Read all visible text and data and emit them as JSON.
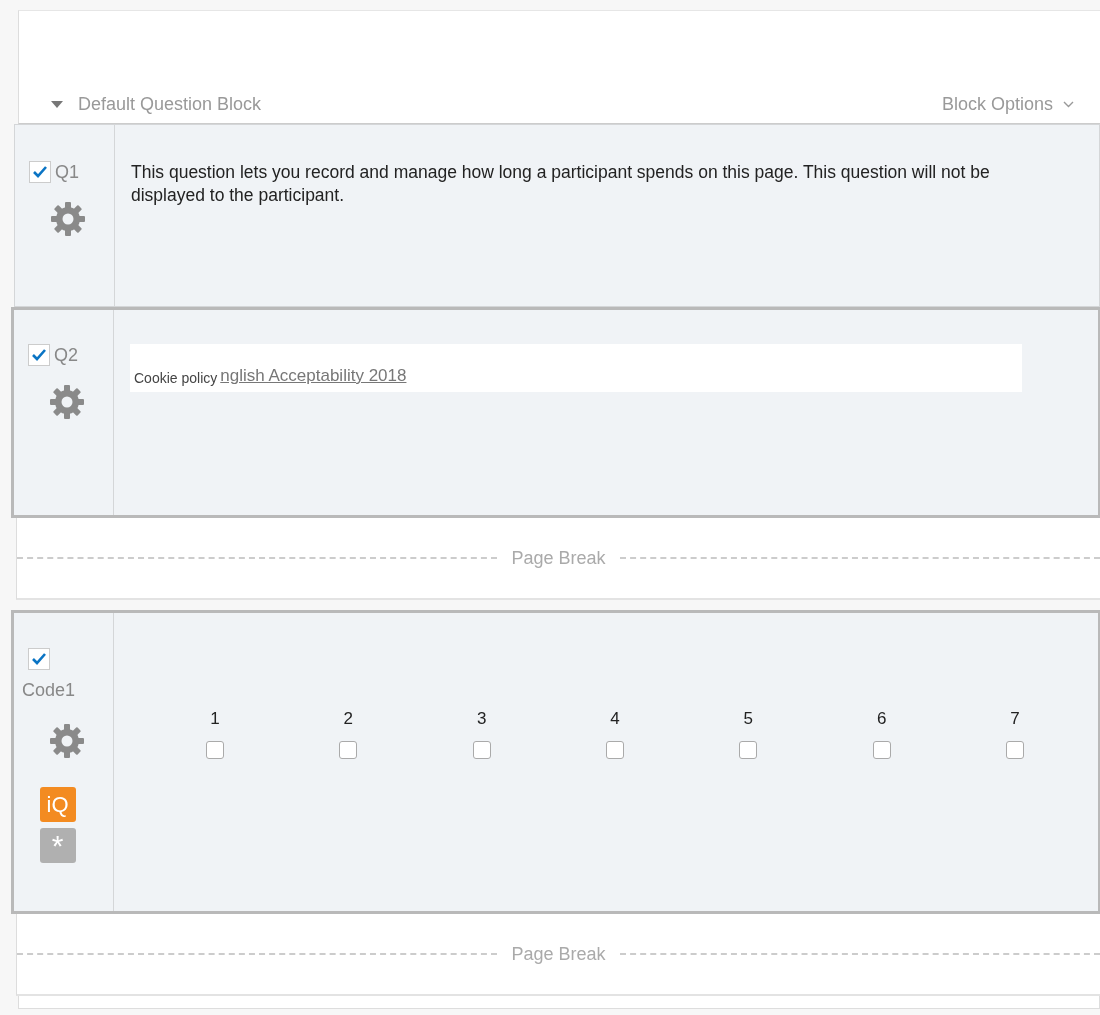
{
  "block": {
    "title": "Default Question Block",
    "expanded": true,
    "options": "Block Options"
  },
  "items": [
    {
      "kind": "question",
      "id": "Q1",
      "checked": true,
      "selected": false,
      "stacked": false,
      "text": "This question lets you record and manage how long a participant spends on this page. This question will not be displayed to the participant."
    },
    {
      "kind": "question",
      "id": "Q2",
      "checked": true,
      "selected": true,
      "stacked": false,
      "overlay": "Cookie policy",
      "link": "nglish Acceptability 2018"
    },
    {
      "kind": "page_break",
      "label": "Page Break"
    },
    {
      "kind": "question",
      "id": "Code1",
      "checked": true,
      "selected": true,
      "stacked": true,
      "choices": [
        {
          "label": "1",
          "checked": false
        },
        {
          "label": "2",
          "checked": false
        },
        {
          "label": "3",
          "checked": false
        },
        {
          "label": "4",
          "checked": false
        },
        {
          "label": "5",
          "checked": false
        },
        {
          "label": "6",
          "checked": false
        },
        {
          "label": "7",
          "checked": false
        }
      ],
      "badges": [
        {
          "kind": "iq",
          "text": "iQ"
        },
        {
          "kind": "required",
          "text": "*"
        }
      ]
    },
    {
      "kind": "page_break",
      "label": "Page Break"
    }
  ]
}
